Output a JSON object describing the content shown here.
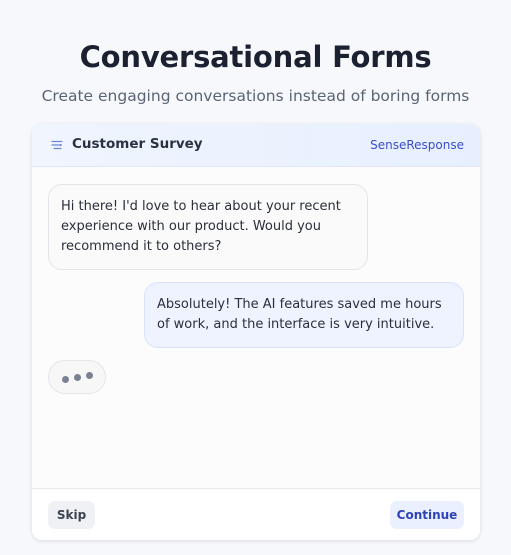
{
  "page": {
    "title": "Conversational Forms",
    "subtitle": "Create engaging conversations instead of boring forms"
  },
  "card": {
    "icon": "list-settings-icon",
    "title": "Customer Survey",
    "brand": "SenseResponse"
  },
  "messages": [
    {
      "role": "bot",
      "text": "Hi there! I'd love to hear about your recent experience with our product. Would you recommend it to others?"
    },
    {
      "role": "user",
      "text": "Absolutely! The AI features saved me hours of work, and the interface is very intuitive."
    }
  ],
  "typing_indicator": {
    "icon": "typing-dots-icon"
  },
  "footer": {
    "skip_label": "Skip",
    "continue_label": "Continue"
  },
  "colors": {
    "accent": "#3b4ec8",
    "header_bg": "#eaf1ff",
    "user_bubble_bg": "#eef3ff"
  }
}
